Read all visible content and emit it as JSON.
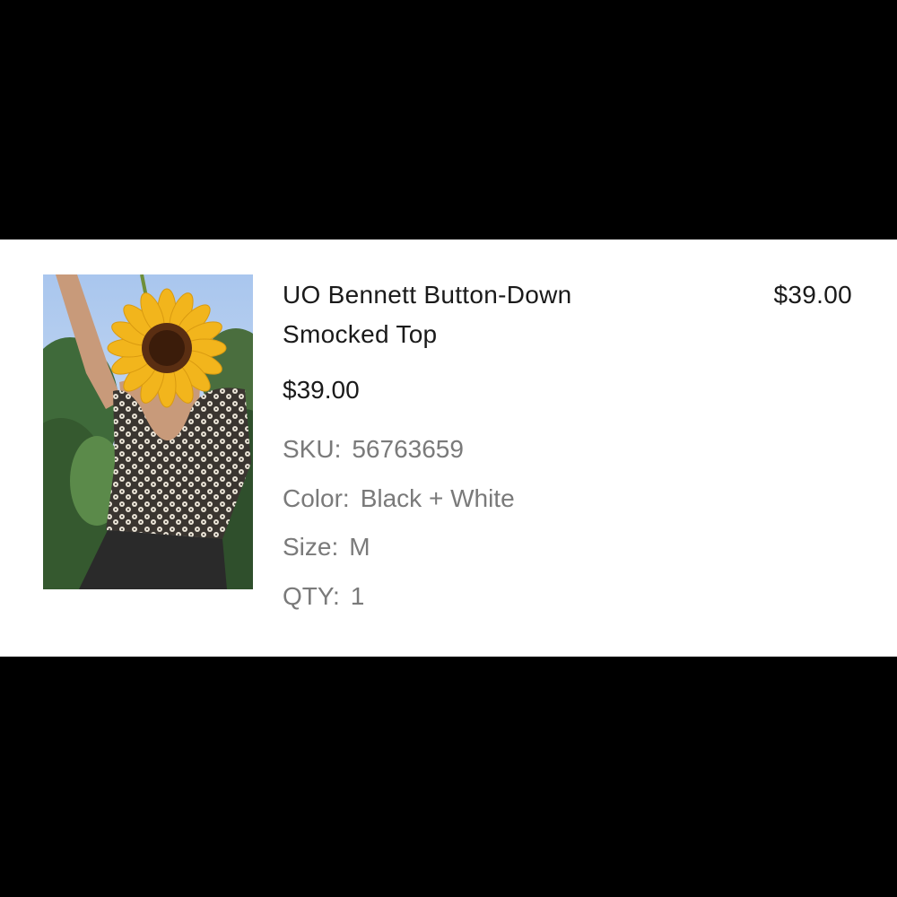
{
  "product": {
    "title_line1": "UO Bennett Button-Down",
    "title_line2": "Smocked Top",
    "line_total": "$39.00",
    "unit_price": "$39.00",
    "sku_label": "SKU:",
    "sku_value": "56763659",
    "color_label": "Color:",
    "color_value": "Black + White",
    "size_label": "Size:",
    "size_value": "M",
    "qty_label": "QTY:",
    "qty_value": "1",
    "image_icon": "product-photo-sunflower"
  },
  "colors": {
    "background": "#000000",
    "card": "#ffffff",
    "primary_text": "#1a1a1a",
    "secondary_text": "#7a7a7a"
  }
}
